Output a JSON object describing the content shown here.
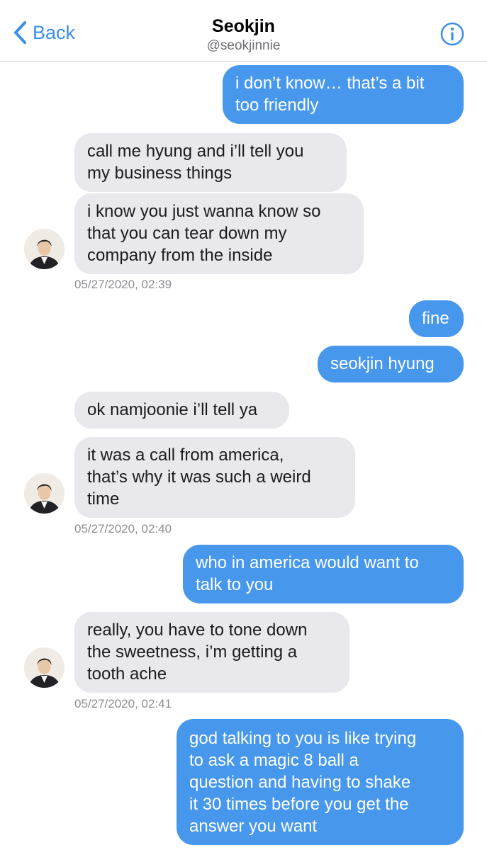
{
  "header": {
    "back_label": "Back",
    "title": "Seokjin",
    "handle": "@seokjinnie"
  },
  "messages": [
    {
      "dir": "out",
      "text": "i don’t know… that’s a bit\ntoo friendly"
    },
    {
      "dir": "in",
      "text": "call me hyung and i’ll tell you\nmy business things"
    },
    {
      "dir": "in",
      "text": "i know you just wanna know so\nthat you can tear down my\ncompany from the inside"
    },
    {
      "dir": "out",
      "text": "fine"
    },
    {
      "dir": "out",
      "text": "seokjin hyung"
    },
    {
      "dir": "in",
      "text": "ok namjoonie i’ll tell ya"
    },
    {
      "dir": "in",
      "text": "it was a call from america,\nthat’s why it was such a weird\ntime"
    },
    {
      "dir": "out",
      "text": "who in america would want to\ntalk to you"
    },
    {
      "dir": "in",
      "text": "really, you have to tone down\nthe sweetness, i’m getting a\ntooth ache"
    },
    {
      "dir": "out",
      "text": "god talking to you is like trying\nto ask a magic 8 ball a\nquestion and having to shake\nit 30 times before you get the\nanswer you want"
    }
  ],
  "timestamps": [
    "05/27/2020, 02:39",
    "05/27/2020, 02:40",
    "05/27/2020, 02:41"
  ],
  "colors": {
    "accent": "#3a8eec",
    "outgoing_bubble": "#4798ec",
    "incoming_bubble": "#e8e8ed"
  },
  "icons": {
    "back": "chevron-left-icon",
    "info": "info-icon",
    "avatar": "profile-avatar"
  }
}
